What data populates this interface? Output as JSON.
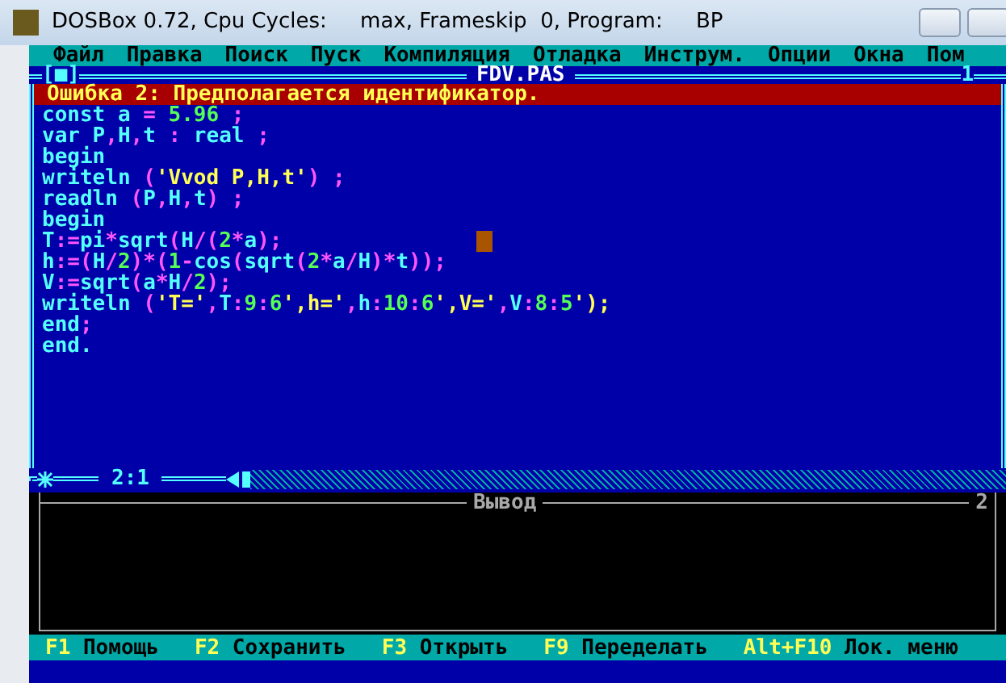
{
  "window": {
    "title": "DOSBox 0.72, Cpu Cycles:     max, Frameskip  0, Program:     BP"
  },
  "menu": [
    "Файл",
    "Правка",
    "Поиск",
    "Пуск",
    "Компиляция",
    "Отладка",
    "Инструм.",
    "Опции",
    "Окна",
    "Пом"
  ],
  "editor": {
    "close_button": "[■]",
    "title": "FDV.PAS",
    "window_number": "1",
    "error": "Ошибка 2: Предполагается идентификатор.",
    "lines": [
      {
        "text": "const a = 5.96 ;",
        "cursor": false
      },
      {
        "text": "var P,H,t : real ;",
        "cursor": false
      },
      {
        "text": "begin",
        "cursor": false
      },
      {
        "text": "writeln ('Vvod P,H,t') ;",
        "cursor": false
      },
      {
        "text": "readln (P,H,t) ;",
        "cursor": false
      },
      {
        "text": "begin",
        "cursor": false
      },
      {
        "text": "T:=pi*sqrt(H/(2*a);",
        "cursor": true
      },
      {
        "text": "h:=(H/2)*(1-cos(sqrt(2*a/H)*t));",
        "cursor": false
      },
      {
        "text": "V:=sqrt(a*H/2);",
        "cursor": false
      },
      {
        "text": "writeln ('T=',T:9:6',h=',h:10:6',V=',V:8:5');",
        "cursor": false
      },
      {
        "text": "end;",
        "cursor": false
      },
      {
        "text": "end.",
        "cursor": false
      }
    ],
    "position": "2:1"
  },
  "output": {
    "title": "Вывод",
    "window_number": "2"
  },
  "status_bar": [
    {
      "key": "F1",
      "label": "Помощь"
    },
    {
      "key": "F2",
      "label": "Сохранить"
    },
    {
      "key": "F3",
      "label": "Открыть"
    },
    {
      "key": "F9",
      "label": "Переделать"
    },
    {
      "key": "Alt+F10",
      "label": "Лок. меню"
    }
  ]
}
